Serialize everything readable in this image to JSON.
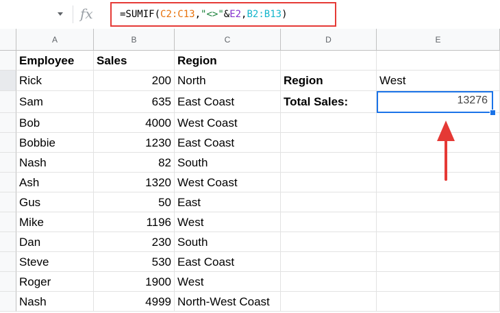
{
  "formula_bar": {
    "fx_label": "fx",
    "formula_parts": [
      {
        "text": "=SUMIF(",
        "color": "#000000"
      },
      {
        "text": "C2:C13",
        "color": "#e8710a"
      },
      {
        "text": ",",
        "color": "#000000"
      },
      {
        "text": "\"<>\"",
        "color": "#188038"
      },
      {
        "text": "&",
        "color": "#000000"
      },
      {
        "text": "E2",
        "color": "#8430ce"
      },
      {
        "text": ",",
        "color": "#000000"
      },
      {
        "text": "B2:B13",
        "color": "#12b5cb"
      },
      {
        "text": ")",
        "color": "#000000"
      }
    ]
  },
  "columns": [
    "A",
    "B",
    "C",
    "D",
    "E"
  ],
  "headers": {
    "employee": "Employee",
    "sales": "Sales",
    "region": "Region"
  },
  "rows": [
    {
      "employee": "Rick",
      "sales": "200",
      "region": "North"
    },
    {
      "employee": "Sam",
      "sales": "635",
      "region": "East Coast"
    },
    {
      "employee": "Bob",
      "sales": "4000",
      "region": "West Coast"
    },
    {
      "employee": "Bobbie",
      "sales": "1230",
      "region": "East Coast"
    },
    {
      "employee": "Nash",
      "sales": "82",
      "region": "South"
    },
    {
      "employee": "Ash",
      "sales": "1320",
      "region": "West Coast"
    },
    {
      "employee": "Gus",
      "sales": "50",
      "region": "East"
    },
    {
      "employee": "Mike",
      "sales": "1196",
      "region": "West"
    },
    {
      "employee": "Dan",
      "sales": "230",
      "region": "South"
    },
    {
      "employee": "Steve",
      "sales": "530",
      "region": "East Coast"
    },
    {
      "employee": "Roger",
      "sales": "1900",
      "region": "West"
    },
    {
      "employee": "Nash",
      "sales": "4999",
      "region": "North-West Coast"
    }
  ],
  "criteria": {
    "region_label": "Region",
    "region_value": "West",
    "total_label": "Total Sales:",
    "total_value": "13276"
  },
  "colors": {
    "accent": "#1a73e8",
    "annotation": "#e53935"
  }
}
